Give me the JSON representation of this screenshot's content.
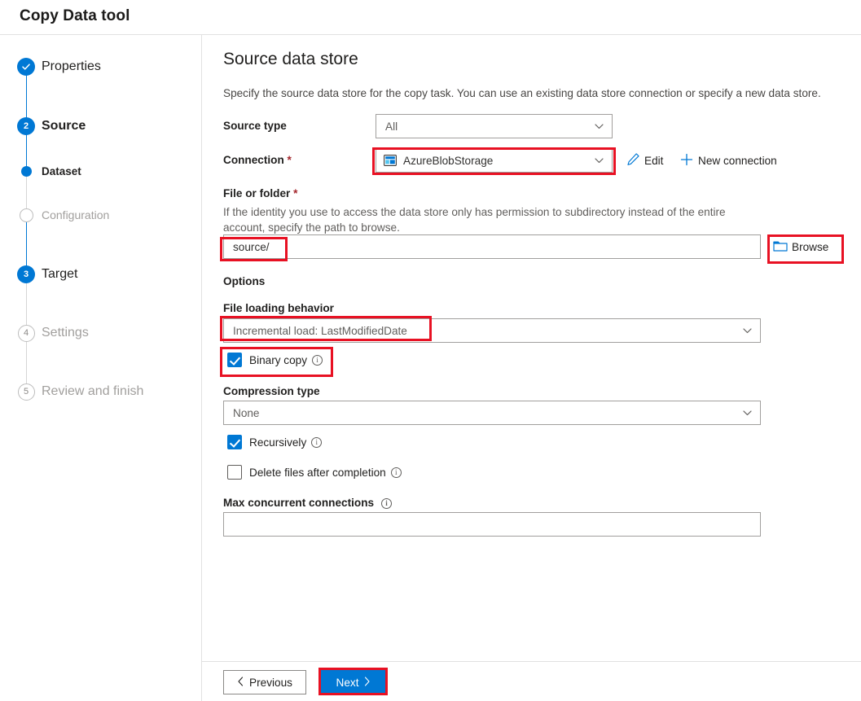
{
  "header": {
    "title": "Copy Data tool"
  },
  "sidebar": {
    "steps": [
      {
        "label": "Properties",
        "marker": "check-icon",
        "state": "complete",
        "type": "main"
      },
      {
        "label": "Source",
        "marker": "2",
        "state": "active",
        "type": "main"
      },
      {
        "label": "Dataset",
        "marker": "dot-icon",
        "state": "active",
        "type": "sub"
      },
      {
        "label": "Configuration",
        "marker": "circle-icon",
        "state": "disabled",
        "type": "sub"
      },
      {
        "label": "Target",
        "marker": "3",
        "state": "upcoming",
        "type": "main"
      },
      {
        "label": "Settings",
        "marker": "4",
        "state": "disabled",
        "type": "main"
      },
      {
        "label": "Review and finish",
        "marker": "5",
        "state": "disabled",
        "type": "main"
      }
    ]
  },
  "main": {
    "title": "Source data store",
    "description": "Specify the source data store for the copy task. You can use an existing data store connection or specify a new data store.",
    "source_type": {
      "label": "Source type",
      "value": "All"
    },
    "connection": {
      "label": "Connection",
      "required_mark": "*",
      "value": "AzureBlobStorage",
      "icon": "azure-blob-icon",
      "edit_label": "Edit",
      "edit_icon": "pencil-icon",
      "new_connection_label": "New connection",
      "new_connection_icon": "plus-icon"
    },
    "file_or_folder": {
      "label": "File or folder",
      "required_mark": "*",
      "help": "If the identity you use to access the data store only has permission to subdirectory instead of the entire account, specify the path to browse.",
      "value": "source/",
      "browse_label": "Browse",
      "browse_icon": "folder-icon"
    },
    "options": {
      "section_label": "Options",
      "file_loading_behavior": {
        "label": "File loading behavior",
        "value": "Incremental load: LastModifiedDate"
      },
      "binary_copy": {
        "label": "Binary copy",
        "checked": true,
        "info_icon": "info-icon"
      },
      "compression_type": {
        "label": "Compression type",
        "value": "None"
      },
      "recursively": {
        "label": "Recursively",
        "checked": true,
        "info_icon": "info-icon"
      },
      "delete_files": {
        "label": "Delete files after completion",
        "checked": false,
        "info_icon": "info-icon"
      },
      "max_concurrent_connections": {
        "label": "Max concurrent connections",
        "value": "",
        "placeholder": "",
        "info_icon": "info-icon"
      }
    }
  },
  "footer": {
    "previous_label": "Previous",
    "next_label": "Next",
    "previous_icon": "chevron-left-icon",
    "next_icon": "chevron-right-icon"
  },
  "colors": {
    "accent": "#0078d4",
    "annotation": "#e81123",
    "required": "#a4262c",
    "muted_text": "#a19f9d"
  }
}
